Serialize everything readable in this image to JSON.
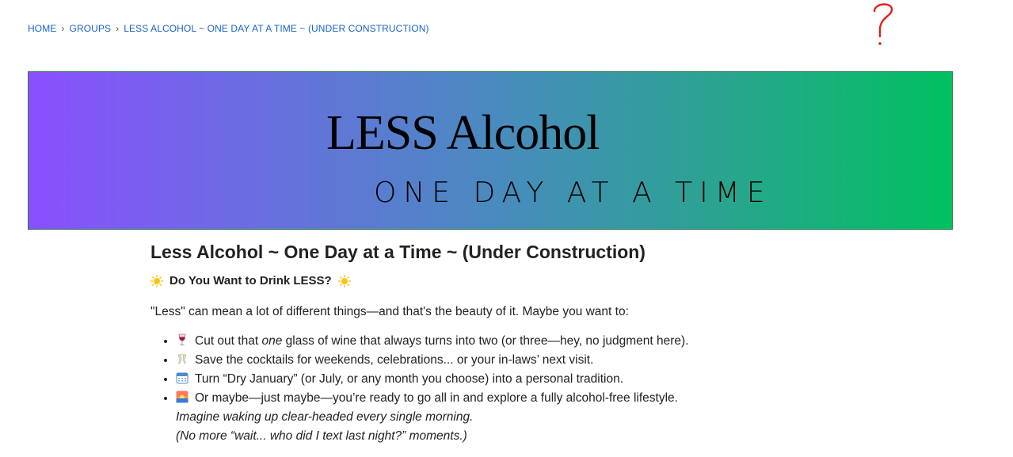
{
  "breadcrumb": {
    "home": "HOME",
    "groups": "GROUPS",
    "current": "LESS ALCOHOL ~ ONE DAY AT A TIME ~ (UNDER CONSTRUCTION)",
    "separator": "›"
  },
  "banner": {
    "title": "LESS Alcohol",
    "subtitle": "ONE DAY AT A TIME",
    "gradient_start": "#8a4fff",
    "gradient_end": "#00c060"
  },
  "page": {
    "title": "Less Alcohol ~ One Day at a Time ~ (Under Construction)",
    "subhead": "Do You Want to Drink LESS?",
    "intro": "\"Less\" can mean a lot of different things—and that's the beauty of it. Maybe you want to:"
  },
  "list": {
    "item1_pre": "Cut out that ",
    "item1_em": "one",
    "item1_post": " glass of wine that always turns into two (or three—hey, no judgment here).",
    "item2": "Save the cocktails for weekends, celebrations... or your in-laws’ next visit.",
    "item3": "Turn “Dry January” (or July, or any month you choose) into a personal tradition.",
    "item4": "Or maybe—just maybe—you’re ready to go all in and explore a fully alcohol-free lifestyle.",
    "note1": "Imagine waking up clear-headed every single morning.",
    "note2": "(No more “wait... who did I text last night?” moments.)"
  },
  "icons": {
    "sun": "sun-icon",
    "wine": "wine-glass-icon",
    "cocktail": "cocktail-glass-icon",
    "calendar": "calendar-icon",
    "sunrise": "sunrise-icon",
    "help": "question-mark-icon"
  },
  "colors": {
    "link": "#1a62c9",
    "help_mark": "#e02020"
  }
}
